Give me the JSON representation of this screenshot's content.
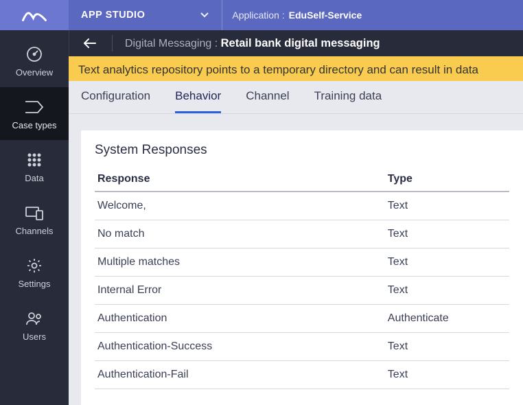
{
  "topbar": {
    "studio_label": "APP STUDIO",
    "app_prefix": "Application :",
    "app_name": "EduSelf-Service"
  },
  "sidebar": {
    "items": [
      {
        "label": "Overview",
        "icon": "gauge-icon"
      },
      {
        "label": "Case types",
        "icon": "tag-icon"
      },
      {
        "label": "Data",
        "icon": "grid-icon"
      },
      {
        "label": "Channels",
        "icon": "devices-icon"
      },
      {
        "label": "Settings",
        "icon": "gear-icon"
      },
      {
        "label": "Users",
        "icon": "users-icon"
      }
    ],
    "active_index": 1
  },
  "breadcrumb": {
    "section": "Digital Messaging :",
    "title": "Retail bank digital messaging"
  },
  "warning": "Text analytics repository points to a temporary directory and can result in data",
  "tabs": {
    "items": [
      "Configuration",
      "Behavior",
      "Channel",
      "Training data"
    ],
    "active_index": 1
  },
  "responses": {
    "heading": "System Responses",
    "columns": [
      "Response",
      "Type"
    ],
    "rows": [
      {
        "response": "Welcome,",
        "type": "Text"
      },
      {
        "response": "No match",
        "type": "Text"
      },
      {
        "response": "Multiple matches",
        "type": "Text"
      },
      {
        "response": "Internal Error",
        "type": "Text"
      },
      {
        "response": "Authentication",
        "type": "Authenticate"
      },
      {
        "response": "Authentication-Success",
        "type": "Text"
      },
      {
        "response": "Authentication-Fail",
        "type": "Text"
      }
    ]
  }
}
